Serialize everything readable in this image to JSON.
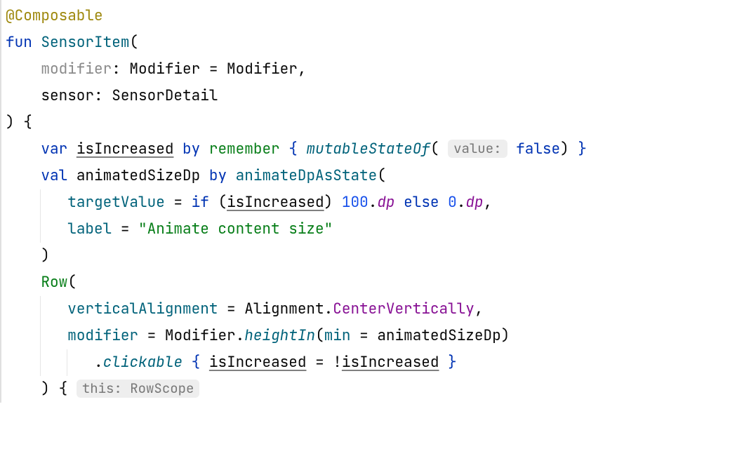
{
  "colors": {
    "annotation": "#9e880d",
    "keyword": "#0033b3",
    "function_teal": "#00627a",
    "grey": "#8a8a8a",
    "property": "#871094",
    "number": "#1750eb",
    "string_green": "#067d17",
    "hint_bg": "#eeeeee",
    "hint_fg": "#787878"
  },
  "code": {
    "l1": {
      "annotation": "@Composable"
    },
    "l2": {
      "kw_fun": "fun",
      "name": "SensorItem",
      "open": "("
    },
    "l3": {
      "param": "modifier",
      "colon": ": ",
      "type": "Modifier",
      "eq": " = ",
      "default": "Modifier",
      "comma": ","
    },
    "l4": {
      "param": "sensor",
      "colon": ": ",
      "type": "SensorDetail"
    },
    "l5": {
      "close_open": ") {"
    },
    "l6": {
      "kw_var": "var",
      "name": "isIncreased",
      "by": "by",
      "remember": "remember",
      "brace_open": "{",
      "mutablestate": "mutableStateOf",
      "hint": "value:",
      "false": "false",
      "close": ") }"
    },
    "l7": {
      "kw_val": "val",
      "name": "animatedSizeDp",
      "by": "by",
      "call": "animateDpAsState",
      "open": "("
    },
    "l8": {
      "targetValue": "targetValue",
      "eq": " = ",
      "kw_if": "if",
      "open": "(",
      "cond": "isIncreased",
      "close": ")",
      "n100": "100",
      "dot": ".",
      "dp1": "dp",
      "kw_else": "else",
      "n0": "0",
      "dp2": "dp",
      "comma": ","
    },
    "l9": {
      "label": "label",
      "eq": " = ",
      "str": "\"Animate content size\""
    },
    "l10": {
      "close": ")"
    },
    "l11": {
      "row": "Row",
      "open": "("
    },
    "l12": {
      "verticalAlignment": "verticalAlignment",
      "eq": " = ",
      "alignment": "Alignment",
      "dot": ".",
      "center": "CenterVertically",
      "comma": ","
    },
    "l13": {
      "modifier": "modifier",
      "eq": " = ",
      "Modifier": "Modifier",
      "dot": ".",
      "heightIn": "heightIn",
      "open": "(",
      "min": "min",
      "eq2": " = ",
      "animatedSizeDp": "animatedSizeDp",
      "close": ")"
    },
    "l14": {
      "dot": ".",
      "clickable": "clickable",
      "brace_open": "{",
      "lhs": "isIncreased",
      "eq": " = ",
      "bang": "!",
      "rhs": "isIncreased",
      "brace_close": "}"
    },
    "l15": {
      "close_open": ") {",
      "hint": "this: RowScope"
    }
  }
}
